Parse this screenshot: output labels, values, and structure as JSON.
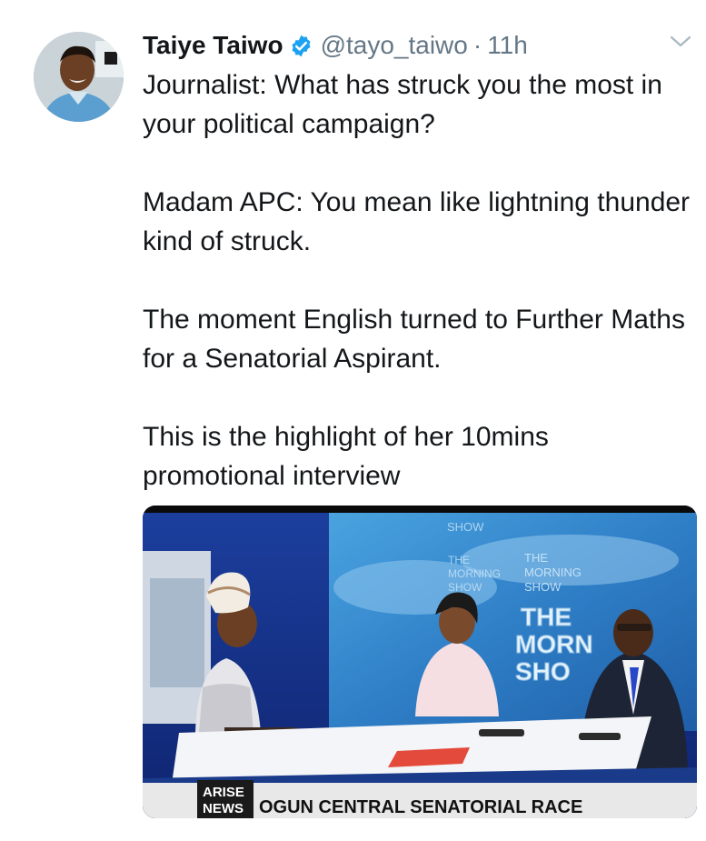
{
  "tweet": {
    "author_name": "Taiye Taiwo",
    "handle": "@tayo_taiwo",
    "separator": "·",
    "time": "11h",
    "verified": true,
    "paragraphs": [
      "Journalist: What has struck you the most in your political campaign?",
      "Madam APC: You mean like lightning thunder kind of struck.",
      "The moment English turned to Further Maths for a Senatorial Aspirant.",
      "This is the highlight of her 10mins promotional interview"
    ]
  },
  "media": {
    "backdrop_text": [
      "SHOW",
      "THE",
      "MORNING",
      "SHOW",
      "THE",
      "MORNING",
      "SHOW",
      "THE",
      "MORN",
      "SHO"
    ],
    "logo_top": "ARISE",
    "logo_bottom": "NEWS",
    "ticker": "OGUN CENTRAL SENATORIAL RACE"
  },
  "icons": {
    "verified": "verified-badge-icon",
    "menu": "chevron-down-icon"
  },
  "colors": {
    "verified": "#1da1f2",
    "secondary_text": "#657786",
    "primary_text": "#14171a"
  }
}
